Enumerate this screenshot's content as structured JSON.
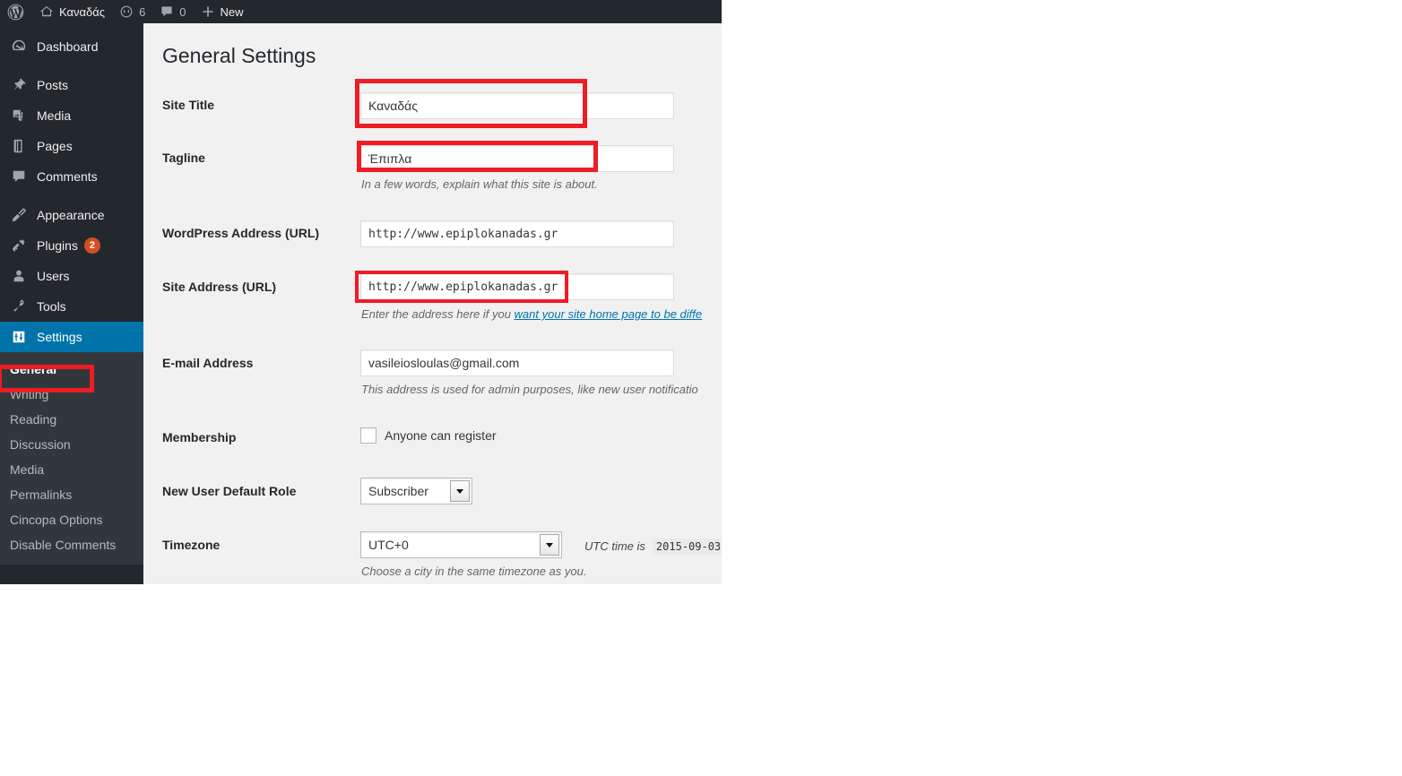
{
  "adminbar": {
    "site_name": "Καναδάς",
    "updates_count": "6",
    "comments_count": "0",
    "new_label": "New",
    "logo_icon": "wordpress-logo-icon",
    "home_icon": "home-icon",
    "updates_icon": "updates-icon",
    "comments_icon": "comment-bubble-icon",
    "new_icon": "plus-icon"
  },
  "sidebar": {
    "items": [
      {
        "label": "Dashboard",
        "icon": "dashboard-icon",
        "badge": ""
      },
      {
        "label": "Posts",
        "icon": "pin-icon",
        "badge": ""
      },
      {
        "label": "Media",
        "icon": "media-icon",
        "badge": ""
      },
      {
        "label": "Pages",
        "icon": "pages-icon",
        "badge": ""
      },
      {
        "label": "Comments",
        "icon": "comment-bubble-icon",
        "badge": ""
      },
      {
        "label": "Appearance",
        "icon": "paintbrush-icon",
        "badge": ""
      },
      {
        "label": "Plugins",
        "icon": "plug-icon",
        "badge": "2"
      },
      {
        "label": "Users",
        "icon": "user-icon",
        "badge": ""
      },
      {
        "label": "Tools",
        "icon": "wrench-icon",
        "badge": ""
      },
      {
        "label": "Settings",
        "icon": "settings-sliders-icon",
        "badge": ""
      }
    ],
    "submenu": [
      {
        "label": "General"
      },
      {
        "label": "Writing"
      },
      {
        "label": "Reading"
      },
      {
        "label": "Discussion"
      },
      {
        "label": "Media"
      },
      {
        "label": "Permalinks"
      },
      {
        "label": "Cincopa Options"
      },
      {
        "label": "Disable Comments"
      }
    ]
  },
  "page": {
    "title": "General Settings",
    "rows": {
      "site_title": {
        "label": "Site Title",
        "value": "Καναδάς"
      },
      "tagline": {
        "label": "Tagline",
        "value": "Έπιπλα",
        "description": "In a few words, explain what this site is about."
      },
      "wordpress_address": {
        "label": "WordPress Address (URL)",
        "value": "http://www.epiplokanadas.gr"
      },
      "site_address": {
        "label": "Site Address (URL)",
        "value": "http://www.epiplokanadas.gr",
        "description_before": "Enter the address here if you ",
        "description_link": "want your site home page to be diffe"
      },
      "email_address": {
        "label": "E-mail Address",
        "value": "vasileiosloulas@gmail.com",
        "description": "This address is used for admin purposes, like new user notificatio"
      },
      "membership": {
        "label": "Membership",
        "checkbox_label": "Anyone can register",
        "checked": false
      },
      "new_user_default_role": {
        "label": "New User Default Role",
        "value": "Subscriber"
      },
      "timezone": {
        "label": "Timezone",
        "value": "UTC+0",
        "utc_note_label": "UTC time is",
        "utc_note_value": "2015-09-03",
        "description": "Choose a city in the same timezone as you."
      }
    }
  },
  "colors": {
    "annotation": "#ee1c25",
    "admin_blue": "#0073aa",
    "badge_orange": "#d54e21",
    "sidebar_bg": "#23282d",
    "submenu_bg": "#32373c",
    "content_bg": "#f1f1f1"
  }
}
